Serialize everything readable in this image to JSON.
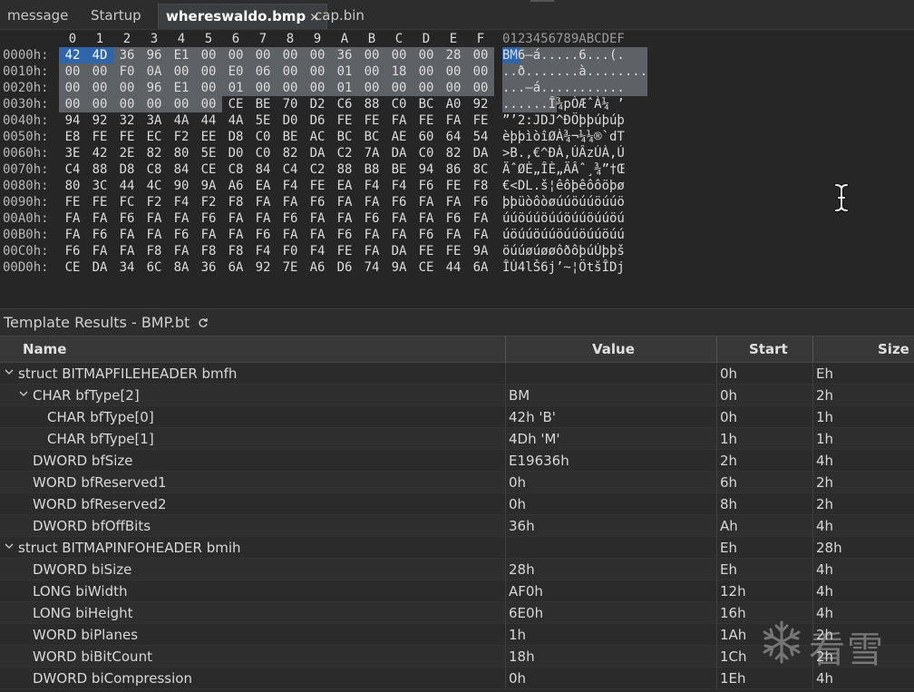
{
  "tabs": [
    {
      "label": "message",
      "active": false
    },
    {
      "label": "Startup",
      "active": false
    },
    {
      "label": "whereswaldo.bmp",
      "active": true,
      "close": "×"
    },
    {
      "label": "cap.bin",
      "active": false
    }
  ],
  "hex": {
    "column_header": [
      "0",
      "1",
      "2",
      "3",
      "4",
      "5",
      "6",
      "7",
      "8",
      "9",
      "A",
      "B",
      "C",
      "D",
      "E",
      "F"
    ],
    "ascii_header": "0123456789ABCDEF",
    "rows": [
      {
        "addr": "0000h:",
        "bytes": [
          "42",
          "4D",
          "36",
          "96",
          "E1",
          "00",
          "00",
          "00",
          "00",
          "00",
          "36",
          "00",
          "00",
          "00",
          "28",
          "00"
        ],
        "ascii": "BM6–á.....6...(."
      },
      {
        "addr": "0010h:",
        "bytes": [
          "00",
          "00",
          "F0",
          "0A",
          "00",
          "00",
          "E0",
          "06",
          "00",
          "00",
          "01",
          "00",
          "18",
          "00",
          "00",
          "00"
        ],
        "ascii": "..ð.......à........"
      },
      {
        "addr": "0020h:",
        "bytes": [
          "00",
          "00",
          "00",
          "96",
          "E1",
          "00",
          "01",
          "00",
          "00",
          "00",
          "01",
          "00",
          "00",
          "00",
          "00",
          "00"
        ],
        "ascii": "...–á..........."
      },
      {
        "addr": "0030h:",
        "bytes": [
          "00",
          "00",
          "00",
          "00",
          "00",
          "00",
          "CE",
          "BE",
          "70",
          "D2",
          "C6",
          "88",
          "C0",
          "BC",
          "A0",
          "92"
        ],
        "ascii": "......Î¾pÒÆˆÀ¼ ’"
      },
      {
        "addr": "0040h:",
        "bytes": [
          "94",
          "92",
          "32",
          "3A",
          "4A",
          "44",
          "4A",
          "5E",
          "D0",
          "D6",
          "FE",
          "FE",
          "FA",
          "FE",
          "FA",
          "FE"
        ],
        "ascii": "”’2:JDJ^ÐÖþþúþúþ"
      },
      {
        "addr": "0050h:",
        "bytes": [
          "E8",
          "FE",
          "FE",
          "EC",
          "F2",
          "EE",
          "D8",
          "C0",
          "BE",
          "AC",
          "BC",
          "BC",
          "AE",
          "60",
          "64",
          "54"
        ],
        "ascii": "èþþìòîØÀ¾¬¼¼®`dT"
      },
      {
        "addr": "0060h:",
        "bytes": [
          "3E",
          "42",
          "2E",
          "82",
          "80",
          "5E",
          "D0",
          "C0",
          "82",
          "DA",
          "C2",
          "7A",
          "DA",
          "C0",
          "82",
          "DA"
        ],
        "ascii": ">B.‚€^ÐÀ‚ÚÂzÚÀ‚Ú"
      },
      {
        "addr": "0070h:",
        "bytes": [
          "C4",
          "88",
          "D8",
          "C8",
          "84",
          "CE",
          "C8",
          "84",
          "C4",
          "C2",
          "88",
          "B8",
          "BE",
          "94",
          "86",
          "8C"
        ],
        "ascii": "ÄˆØÈ„ÎÈ„ÄÂˆ¸¾”†Œ"
      },
      {
        "addr": "0080h:",
        "bytes": [
          "80",
          "3C",
          "44",
          "4C",
          "90",
          "9A",
          "A6",
          "EA",
          "F4",
          "FE",
          "EA",
          "F4",
          "F4",
          "F6",
          "FE",
          "F8"
        ],
        "ascii": "€<DL.š¦êôþêôôöþø"
      },
      {
        "addr": "0090h:",
        "bytes": [
          "FE",
          "FE",
          "FC",
          "F2",
          "F4",
          "F2",
          "F8",
          "FA",
          "FA",
          "F6",
          "FA",
          "FA",
          "F6",
          "FA",
          "FA",
          "F6"
        ],
        "ascii": "þþüòôòøúúöúúöúúö"
      },
      {
        "addr": "00A0h:",
        "bytes": [
          "FA",
          "FA",
          "F6",
          "FA",
          "FA",
          "F6",
          "FA",
          "FA",
          "F6",
          "FA",
          "FA",
          "F6",
          "FA",
          "FA",
          "F6",
          "FA"
        ],
        "ascii": "úúöúúöúúöúúöúúöú"
      },
      {
        "addr": "00B0h:",
        "bytes": [
          "FA",
          "F6",
          "FA",
          "FA",
          "F6",
          "FA",
          "FA",
          "F6",
          "FA",
          "FA",
          "F6",
          "FA",
          "FA",
          "F6",
          "FA",
          "FA"
        ],
        "ascii": "úöúúöúúöúúöúúöúú"
      },
      {
        "addr": "00C0h:",
        "bytes": [
          "F6",
          "FA",
          "FA",
          "F8",
          "FA",
          "F8",
          "F8",
          "F4",
          "F0",
          "F4",
          "FE",
          "FA",
          "DA",
          "FE",
          "FE",
          "9A"
        ],
        "ascii": "öúúøúøøôðôþúÚþþš"
      },
      {
        "addr": "00D0h:",
        "bytes": [
          "CE",
          "DA",
          "34",
          "6C",
          "8A",
          "36",
          "6A",
          "92",
          "7E",
          "A6",
          "D6",
          "74",
          "9A",
          "CE",
          "44",
          "6A"
        ],
        "ascii": "ÎÚ4lŠ6j’~¦ÖtšÎDj"
      }
    ]
  },
  "template": {
    "title": "Template Results - BMP.bt",
    "refresh_icon": "refresh-icon",
    "columns": [
      "Name",
      "Value",
      "Start",
      "Size"
    ],
    "rows": [
      {
        "name": "struct BITMAPFILEHEADER bmfh",
        "value": "",
        "start": "0h",
        "size": "Eh",
        "level": 0,
        "expander": "expanded"
      },
      {
        "name": "CHAR bfType[2]",
        "value": "BM",
        "start": "0h",
        "size": "2h",
        "level": 1,
        "expander": "expanded"
      },
      {
        "name": "CHAR bfType[0]",
        "value": "42h 'B'",
        "start": "0h",
        "size": "1h",
        "level": 2,
        "expander": "none"
      },
      {
        "name": "CHAR bfType[1]",
        "value": "4Dh 'M'",
        "start": "1h",
        "size": "1h",
        "level": 2,
        "expander": "none"
      },
      {
        "name": "DWORD bfSize",
        "value": "E19636h",
        "start": "2h",
        "size": "4h",
        "level": 1,
        "expander": "none"
      },
      {
        "name": "WORD bfReserved1",
        "value": "0h",
        "start": "6h",
        "size": "2h",
        "level": 1,
        "expander": "none"
      },
      {
        "name": "WORD bfReserved2",
        "value": "0h",
        "start": "8h",
        "size": "2h",
        "level": 1,
        "expander": "none"
      },
      {
        "name": "DWORD bfOffBits",
        "value": "36h",
        "start": "Ah",
        "size": "4h",
        "level": 1,
        "expander": "none"
      },
      {
        "name": "struct BITMAPINFOHEADER bmih",
        "value": "",
        "start": "Eh",
        "size": "28h",
        "level": 0,
        "expander": "expanded"
      },
      {
        "name": "DWORD biSize",
        "value": "28h",
        "start": "Eh",
        "size": "4h",
        "level": 1,
        "expander": "none"
      },
      {
        "name": "LONG biWidth",
        "value": "AF0h",
        "start": "12h",
        "size": "4h",
        "level": 1,
        "expander": "none"
      },
      {
        "name": "LONG biHeight",
        "value": "6E0h",
        "start": "16h",
        "size": "4h",
        "level": 1,
        "expander": "none"
      },
      {
        "name": "WORD biPlanes",
        "value": "1h",
        "start": "1Ah",
        "size": "2h",
        "level": 1,
        "expander": "none"
      },
      {
        "name": "WORD biBitCount",
        "value": "18h",
        "start": "1Ch",
        "size": "2h",
        "level": 1,
        "expander": "none"
      },
      {
        "name": "DWORD biCompression",
        "value": "0h",
        "start": "1Eh",
        "size": "4h",
        "level": 1,
        "expander": "none"
      }
    ]
  },
  "watermark": {
    "icon": "snowflake-icon",
    "text": "看雪"
  }
}
